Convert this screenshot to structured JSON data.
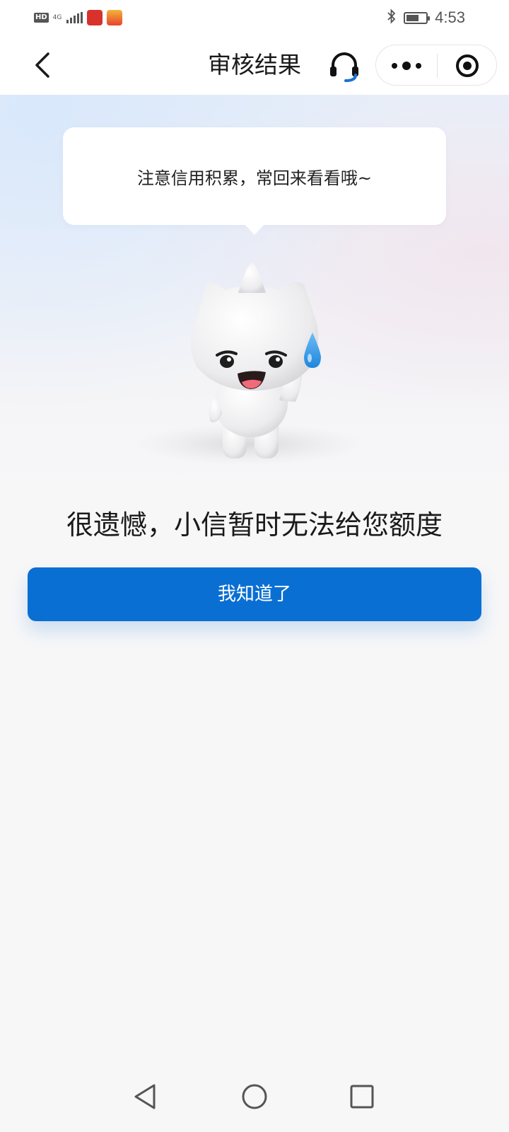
{
  "status_bar": {
    "hd": "HD",
    "network": "4G",
    "time": "4:53",
    "battery_level": 0.55,
    "icons": [
      "hd-icon",
      "signal-icon",
      "app-notification-icon",
      "app-notification-icon",
      "bluetooth-icon",
      "battery-icon"
    ]
  },
  "nav": {
    "title": "审核结果",
    "icons": {
      "back": "chevron-left-icon",
      "service": "headset-icon",
      "more": "more-dots-icon",
      "close": "target-close-icon"
    }
  },
  "bubble": {
    "text": "注意信用积累，常回来看看哦~"
  },
  "mascot": {
    "icon": "sweating-cat-mascot"
  },
  "result": {
    "title": "很遗憾，小信暂时无法给您额度"
  },
  "button": {
    "label": "我知道了"
  },
  "colors": {
    "primary": "#0a6fd3",
    "background": "#f7f7f8",
    "sweat_drop": "#3a9be8"
  },
  "system_nav": {
    "icons": [
      "triangle-back-icon",
      "circle-home-icon",
      "square-recent-icon"
    ]
  }
}
